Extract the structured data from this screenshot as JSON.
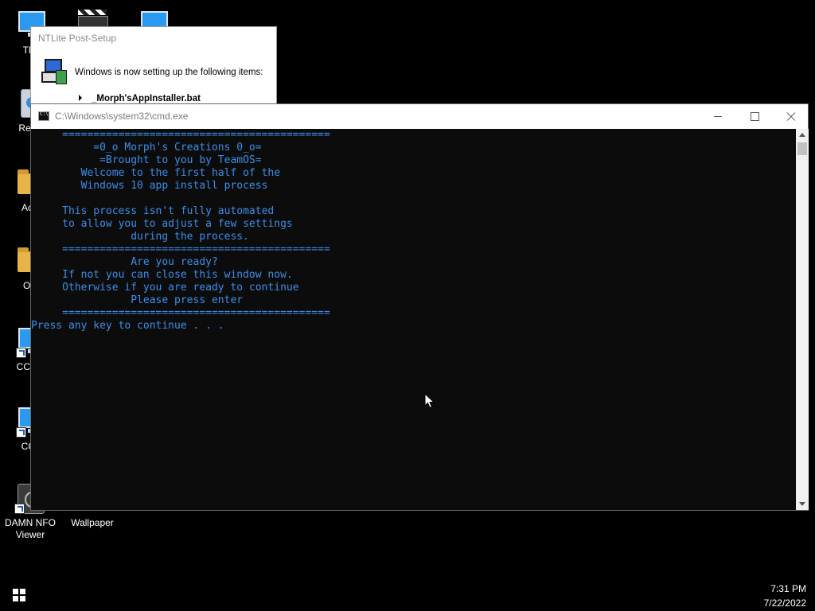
{
  "desktop": {
    "icons": [
      {
        "label": "This",
        "icon": "this-pc-icon"
      },
      {
        "label": "",
        "icon": "media-player-icon"
      },
      {
        "label": "",
        "icon": "program-icon"
      },
      {
        "label": "Recyc",
        "icon": "recycle-bin-icon"
      },
      {
        "label": "Activ",
        "icon": "folder-icon"
      },
      {
        "label": "Opti",
        "icon": "optimizer-icon"
      },
      {
        "label": "CCEnh",
        "icon": "ccenhancer-icon"
      },
      {
        "label": "CCle",
        "icon": "ccleaner-icon"
      },
      {
        "label": "DAMN NFO Viewer",
        "icon": "damn-nfo-viewer-icon"
      },
      {
        "label": "Wallpaper",
        "icon": "wallpaper-icon"
      }
    ]
  },
  "ntlite": {
    "title": "NTLite Post-Setup",
    "message": "Windows is now setting up the following items:",
    "item": "_Morph'sAppInstaller.bat"
  },
  "cmd": {
    "title": "C:\\Windows\\system32\\cmd.exe",
    "lines": [
      "     ===========================================",
      "          =0_o Morph's Creations 0_o=",
      "           =Brought to you by TeamOS=",
      "        Welcome to the first half of the",
      "        Windows 10 app install process",
      "",
      "     This process isn't fully automated",
      "     to allow you to adjust a few settings",
      "                during the process.",
      "     ===========================================",
      "                Are you ready?",
      "     If not you can close this window now.",
      "     Otherwise if you are ready to continue",
      "                Please press enter",
      "     ===========================================",
      "Press any key to continue . . ."
    ],
    "text_color": "#3b8eea"
  },
  "taskbar": {
    "time": "7:31 PM",
    "date": "7/22/2022"
  }
}
